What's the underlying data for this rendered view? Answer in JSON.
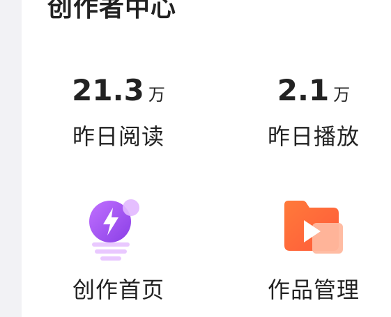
{
  "header": {
    "title": "创作者中心"
  },
  "stats": [
    {
      "value": "21.3",
      "unit": "万",
      "label": "昨日阅读"
    },
    {
      "value": "2.1",
      "unit": "万",
      "label": "昨日播放"
    }
  ],
  "tiles": [
    {
      "label": "创作首页",
      "icon": "lightbulb-lightning-icon"
    },
    {
      "label": "作品管理",
      "icon": "video-folder-icon"
    }
  ],
  "colors": {
    "gutter": "#f2f2f5",
    "text": "#222222",
    "bulb_purple": "#a64ff0",
    "folder_orange": "#ff6a3d"
  }
}
